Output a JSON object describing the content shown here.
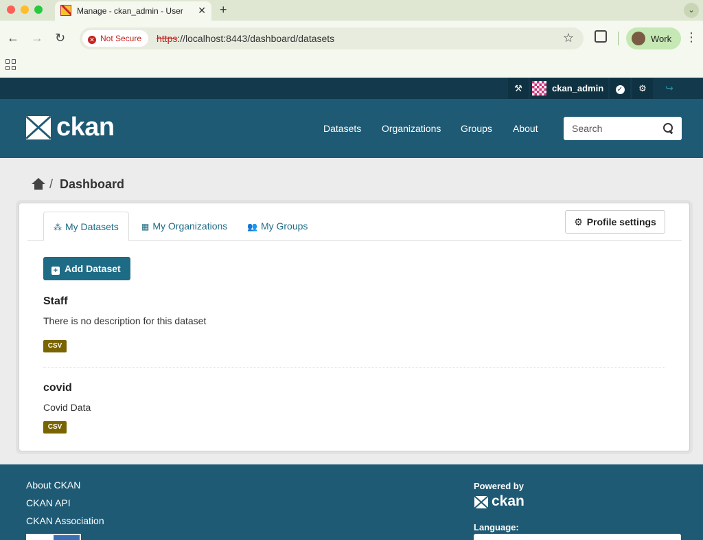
{
  "browser": {
    "tab_title": "Manage - ckan_admin - User",
    "new_tab": "+",
    "security_label": "Not Secure",
    "url_scheme": "https",
    "url_rest": "://localhost:8443/dashboard/datasets",
    "profile_label": "Work"
  },
  "account": {
    "username": "ckan_admin"
  },
  "site": {
    "logo_text": "ckan",
    "nav": [
      "Datasets",
      "Organizations",
      "Groups",
      "About"
    ],
    "search_placeholder": "Search"
  },
  "breadcrumb": {
    "separator": "/",
    "current": "Dashboard"
  },
  "dashboard": {
    "tabs": [
      "My Datasets",
      "My Organizations",
      "My Groups"
    ],
    "active_tab": "My Datasets",
    "profile_settings_label": "Profile settings",
    "add_dataset_label": "Add Dataset",
    "datasets": [
      {
        "title": "Staff",
        "description": "There is no description for this dataset",
        "format": "CSV"
      },
      {
        "title": "covid",
        "description": "Covid Data",
        "format": "CSV"
      }
    ]
  },
  "footer": {
    "links": [
      "About CKAN",
      "CKAN API",
      "CKAN Association"
    ],
    "powered_by": "Powered by",
    "logo_text": "ckan",
    "language_label": "Language:"
  },
  "colors": {
    "masthead": "#1e5a74",
    "account_bar": "#123a4c",
    "primary_button": "#1e6b85",
    "format_badge": "#7a6400"
  }
}
